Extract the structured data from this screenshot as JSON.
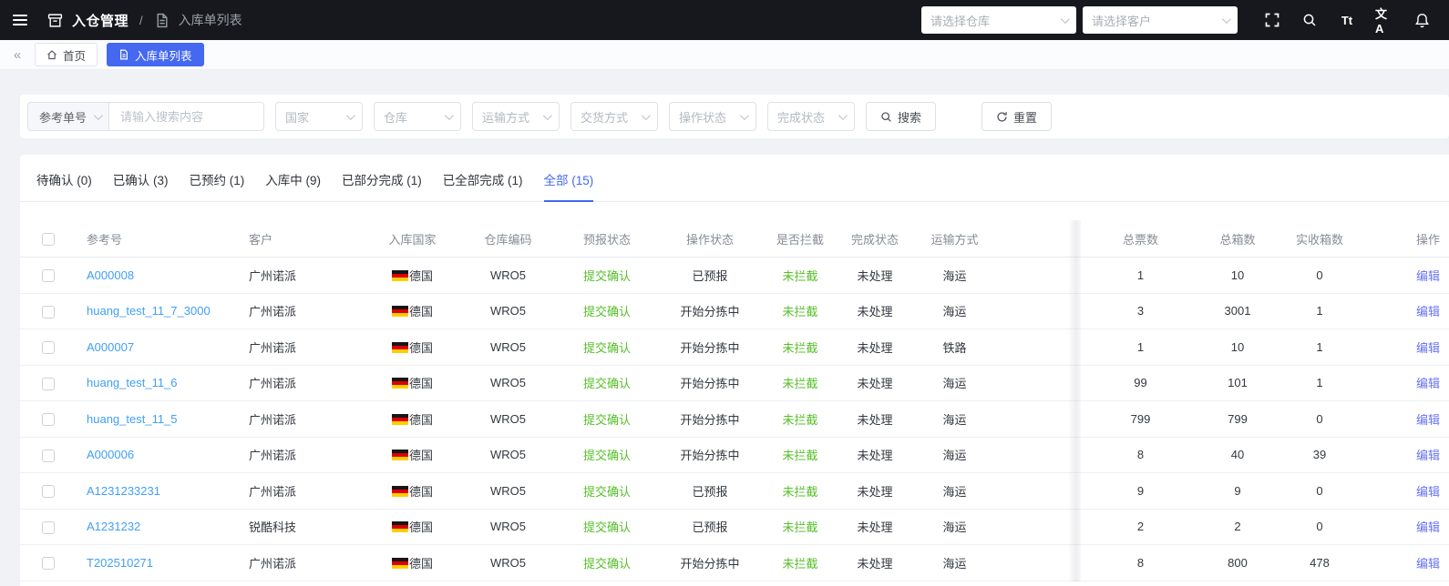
{
  "topnav": {
    "module_title": "入仓管理",
    "separator": "/",
    "page_title": "入库单列表",
    "warehouse_placeholder": "请选择仓库",
    "customer_placeholder": "请选择客户",
    "font_size_icon_label": "Tt",
    "translate_icon_label": "文A"
  },
  "tagbar": {
    "collapse_icon": "«",
    "home_label": "首页",
    "active_label": "入库单列表"
  },
  "filters": {
    "type_select_value": "参考单号",
    "keyword_placeholder": "请输入搜索内容",
    "selects": [
      {
        "placeholder": "国家"
      },
      {
        "placeholder": "仓库"
      },
      {
        "placeholder": "运输方式"
      },
      {
        "placeholder": "交货方式"
      },
      {
        "placeholder": "操作状态"
      },
      {
        "placeholder": "完成状态"
      }
    ],
    "search_label": "搜索",
    "reset_label": "重置"
  },
  "status_tabs": [
    {
      "label": "待确认 (0)",
      "active": false
    },
    {
      "label": "已确认 (3)",
      "active": false
    },
    {
      "label": "已预约 (1)",
      "active": false
    },
    {
      "label": "入库中 (9)",
      "active": false
    },
    {
      "label": "已部分完成 (1)",
      "active": false
    },
    {
      "label": "已全部完成 (1)",
      "active": false
    },
    {
      "label": "全部 (15)",
      "active": true
    }
  ],
  "table": {
    "columns": [
      "参考号",
      "客户",
      "入库国家",
      "仓库编码",
      "预报状态",
      "操作状态",
      "是否拦截",
      "完成状态",
      "运输方式",
      "总票数",
      "总箱数",
      "实收箱数",
      "操作"
    ],
    "edit_label": "编辑",
    "rows": [
      {
        "ref": "A000008",
        "customer": "广州诺派",
        "country": "德国",
        "warehouse": "WRO5",
        "forecast": "提交确认",
        "operation": "已预报",
        "intercept": "未拦截",
        "finish": "未处理",
        "transport": "海运",
        "tickets": "1",
        "boxes": "10",
        "received": "0"
      },
      {
        "ref": "huang_test_11_7_3000",
        "customer": "广州诺派",
        "country": "德国",
        "warehouse": "WRO5",
        "forecast": "提交确认",
        "operation": "开始分拣中",
        "intercept": "未拦截",
        "finish": "未处理",
        "transport": "海运",
        "tickets": "3",
        "boxes": "3001",
        "received": "1"
      },
      {
        "ref": "A000007",
        "customer": "广州诺派",
        "country": "德国",
        "warehouse": "WRO5",
        "forecast": "提交确认",
        "operation": "开始分拣中",
        "intercept": "未拦截",
        "finish": "未处理",
        "transport": "铁路",
        "tickets": "1",
        "boxes": "10",
        "received": "1"
      },
      {
        "ref": "huang_test_11_6",
        "customer": "广州诺派",
        "country": "德国",
        "warehouse": "WRO5",
        "forecast": "提交确认",
        "operation": "开始分拣中",
        "intercept": "未拦截",
        "finish": "未处理",
        "transport": "海运",
        "tickets": "99",
        "boxes": "101",
        "received": "1"
      },
      {
        "ref": "huang_test_11_5",
        "customer": "广州诺派",
        "country": "德国",
        "warehouse": "WRO5",
        "forecast": "提交确认",
        "operation": "开始分拣中",
        "intercept": "未拦截",
        "finish": "未处理",
        "transport": "海运",
        "tickets": "799",
        "boxes": "799",
        "received": "0"
      },
      {
        "ref": "A000006",
        "customer": "广州诺派",
        "country": "德国",
        "warehouse": "WRO5",
        "forecast": "提交确认",
        "operation": "开始分拣中",
        "intercept": "未拦截",
        "finish": "未处理",
        "transport": "海运",
        "tickets": "8",
        "boxes": "40",
        "received": "39"
      },
      {
        "ref": "A1231233231",
        "customer": "广州诺派",
        "country": "德国",
        "warehouse": "WRO5",
        "forecast": "提交确认",
        "operation": "已预报",
        "intercept": "未拦截",
        "finish": "未处理",
        "transport": "海运",
        "tickets": "9",
        "boxes": "9",
        "received": "0"
      },
      {
        "ref": "A1231232",
        "customer": "锐酷科技",
        "country": "德国",
        "warehouse": "WRO5",
        "forecast": "提交确认",
        "operation": "已预报",
        "intercept": "未拦截",
        "finish": "未处理",
        "transport": "海运",
        "tickets": "2",
        "boxes": "2",
        "received": "0"
      },
      {
        "ref": "T202510271",
        "customer": "广州诺派",
        "country": "德国",
        "warehouse": "WRO5",
        "forecast": "提交确认",
        "operation": "开始分拣中",
        "intercept": "未拦截",
        "finish": "未处理",
        "transport": "海运",
        "tickets": "8",
        "boxes": "800",
        "received": "478"
      }
    ]
  },
  "colors": {
    "accent_blue": "#4468f0",
    "link_blue": "#409ff7",
    "edit_indigo": "#6672f0",
    "status_green": "#55bf28",
    "flag_black": "#161616",
    "flag_red": "#dd0000",
    "flag_gold": "#ffce00"
  }
}
